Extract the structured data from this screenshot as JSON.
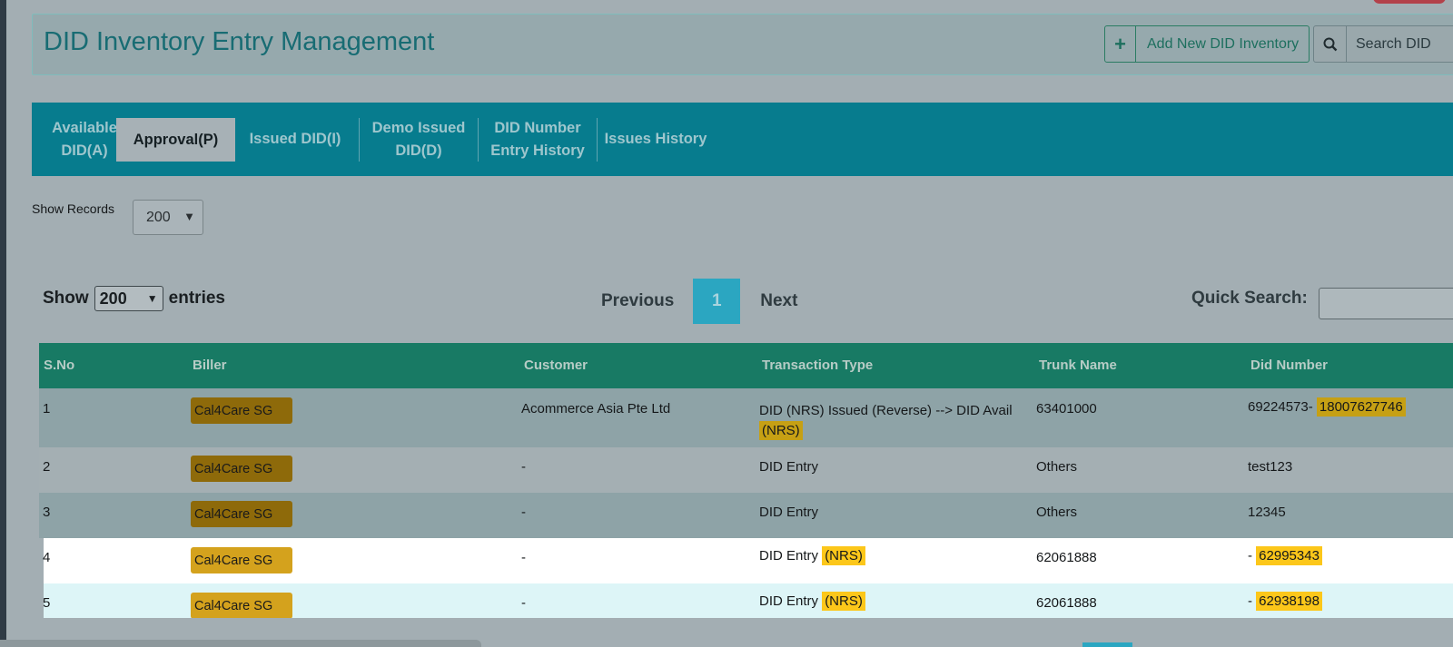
{
  "header": {
    "title": "DID Inventory Entry Management",
    "add_button": "Add New DID Inventory",
    "search_button": "Search DID"
  },
  "tabs": [
    {
      "label_l1": "Available",
      "label_l2": "DID(A)"
    },
    {
      "label_l1": "Approval(P)",
      "label_l2": ""
    },
    {
      "label_l1": "Issued DID(I)",
      "label_l2": ""
    },
    {
      "label_l1": "Demo Issued",
      "label_l2": "DID(D)"
    },
    {
      "label_l1": "DID Number",
      "label_l2": "Entry History"
    },
    {
      "label_l1": "Issues History",
      "label_l2": ""
    }
  ],
  "records": {
    "label": "Show Records",
    "value": "200"
  },
  "entries": {
    "show": "Show",
    "value": "200",
    "suffix": "entries"
  },
  "pager": {
    "previous": "Previous",
    "current": "1",
    "next": "Next"
  },
  "quick_search": {
    "label": "Quick Search:",
    "value": ""
  },
  "table": {
    "headers": [
      "S.No",
      "Biller",
      "Customer",
      "Transaction Type",
      "Trunk Name",
      "Did Number"
    ],
    "rows": [
      {
        "sno": "1",
        "biller": "Cal4Care SG",
        "customer": "Acommerce Asia Pte Ltd",
        "txn": "DID (NRS) Issued (Reverse) --> DID Avail",
        "txn_tag": "(NRS)",
        "trunk": "63401000",
        "did_prefix": "69224573-",
        "did_tag": "18007627746"
      },
      {
        "sno": "2",
        "biller": "Cal4Care SG",
        "customer": "-",
        "txn": "DID Entry",
        "txn_tag": "",
        "trunk": "Others",
        "did_prefix": "test123",
        "did_tag": ""
      },
      {
        "sno": "3",
        "biller": "Cal4Care SG",
        "customer": "-",
        "txn": "DID Entry",
        "txn_tag": "",
        "trunk": "Others",
        "did_prefix": "12345",
        "did_tag": ""
      },
      {
        "sno": "4",
        "biller": "Cal4Care SG",
        "customer": "-",
        "txn": "DID Entry",
        "txn_tag": "(NRS)",
        "trunk": "62061888",
        "did_prefix": "-",
        "did_tag": "62995343"
      },
      {
        "sno": "5",
        "biller": "Cal4Care SG",
        "customer": "-",
        "txn": "DID Entry",
        "txn_tag": "(NRS)",
        "trunk": "62061888",
        "did_prefix": "-",
        "did_tag": "62938198"
      }
    ]
  }
}
